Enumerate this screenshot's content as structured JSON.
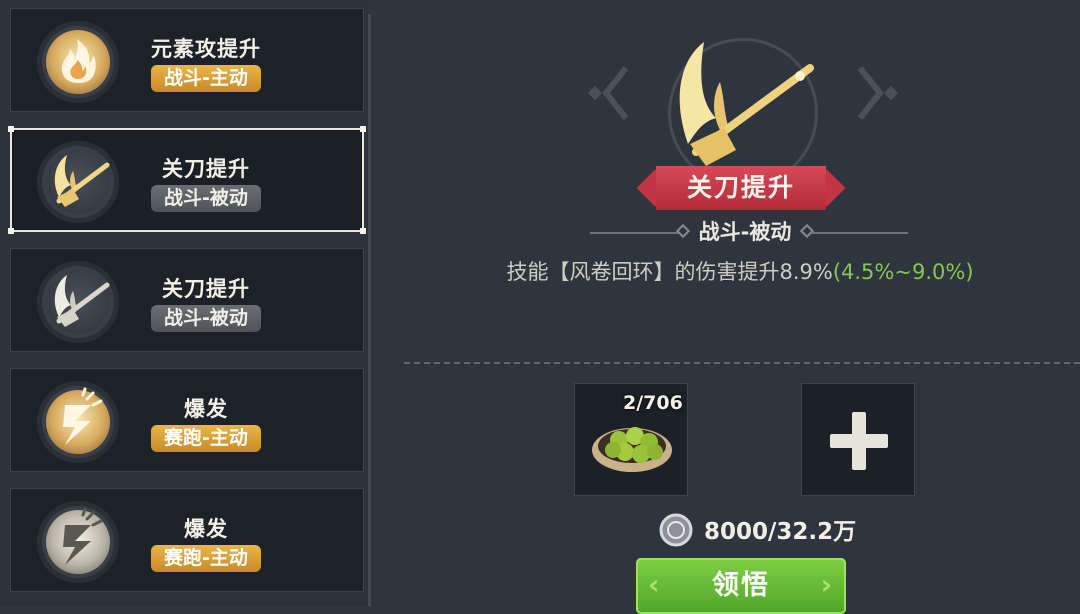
{
  "skills": [
    {
      "name": "元素攻提升",
      "tag": "战斗-主动",
      "icon": "fire-icon"
    },
    {
      "name": "关刀提升",
      "tag": "战斗-被动",
      "icon": "guandao-blade-icon"
    },
    {
      "name": "关刀提升",
      "tag": "战斗-被动",
      "icon": "guandao-blade-icon"
    },
    {
      "name": "爆发",
      "tag": "赛跑-主动",
      "icon": "burst-lightning-icon"
    },
    {
      "name": "爆发",
      "tag": "赛跑-主动",
      "icon": "burst-lightning-icon"
    }
  ],
  "detail": {
    "title": "关刀提升",
    "type": "战斗-被动",
    "desc_main": "技能【风卷回环】的伤害提升8.9%",
    "desc_range": "(4.5%~9.0%)",
    "icon": "guandao-blade-icon"
  },
  "materials": {
    "item_count": "2/706",
    "item_icon": "green-fruit-plate-icon",
    "add_icon": "plus-icon"
  },
  "cost": {
    "coin_icon": "silver-coin-icon",
    "value": "8000/32.2万"
  },
  "action": {
    "label": "领悟"
  },
  "colors": {
    "accent_green": "#86c64c",
    "ribbon_red": "#c33545",
    "tag_gold": "#d9a036"
  }
}
